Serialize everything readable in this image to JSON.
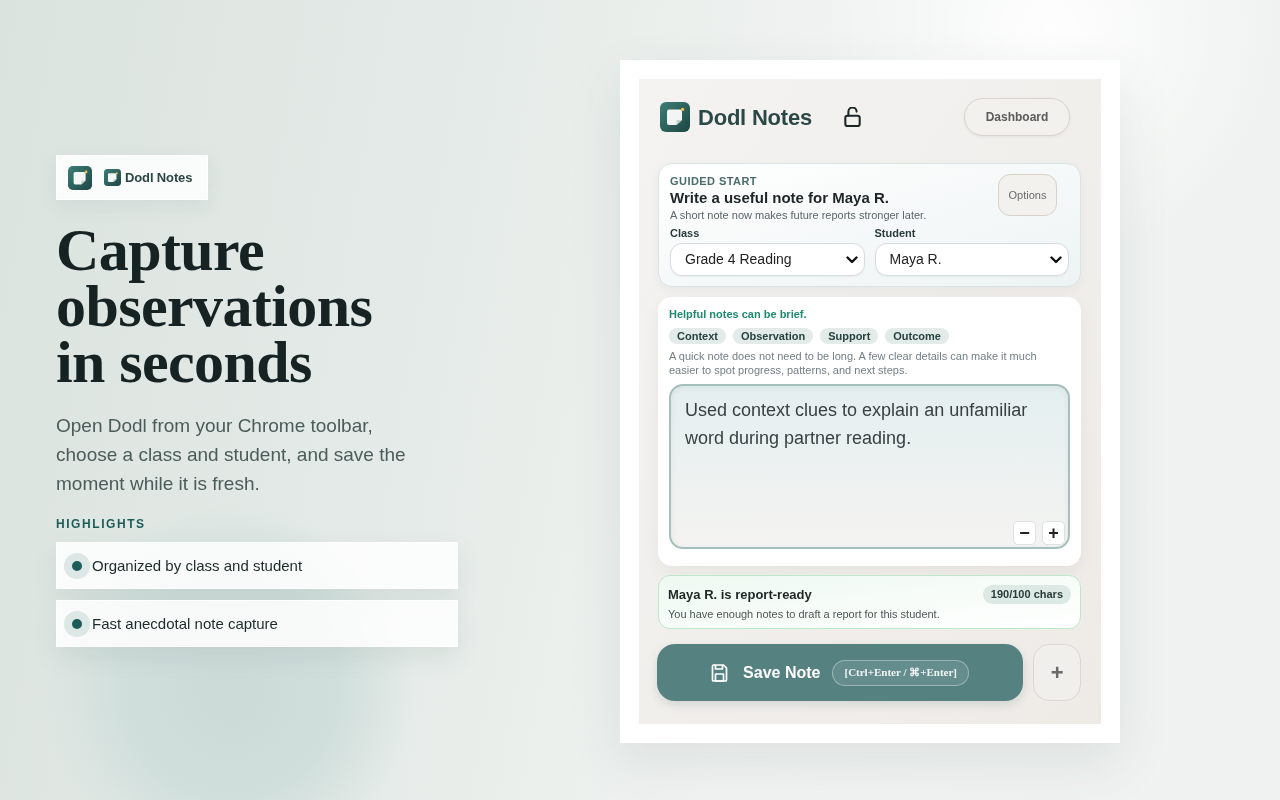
{
  "hero": {
    "badge_label": "Dodl Notes",
    "title": "Capture observations in seconds",
    "description": "Open Dodl from your Chrome toolbar, choose a class and student, and save the moment while it is fresh.",
    "highlights_label": "HIGHLIGHTS",
    "highlights": [
      "Organized by class and student",
      "Fast anecdotal note capture"
    ]
  },
  "popup": {
    "header": {
      "brand": "Dodl Notes",
      "locked": false,
      "dashboard_button": "Dashboard"
    },
    "guided_start": {
      "eyebrow": "GUIDED START",
      "title": "Write a useful note for Maya R.",
      "subtitle": "A short note now makes future reports stronger later.",
      "options_button": "Options",
      "fields": [
        {
          "label": "Class",
          "value": "Grade 4 Reading"
        },
        {
          "label": "Student",
          "value": "Maya R."
        }
      ]
    },
    "tips": {
      "heading": "Helpful notes can be brief.",
      "chips": [
        "Context",
        "Observation",
        "Support",
        "Outcome"
      ],
      "text": "A quick note does not need to be long. A few clear details can make it much easier to spot progress, patterns, and next steps.",
      "note_value": "Used context clues to explain an unfamiliar word during partner reading.",
      "size_buttons": [
        "−",
        "+"
      ]
    },
    "status": {
      "ready": true,
      "title": "Maya R. is report-ready",
      "count": "190/100 chars",
      "text": "You have enough notes to draft a report for this student."
    },
    "save_button": {
      "label": "Save Note",
      "shortcut": "[Ctrl+Enter / ⌘+Enter]"
    },
    "add_button": "+"
  }
}
